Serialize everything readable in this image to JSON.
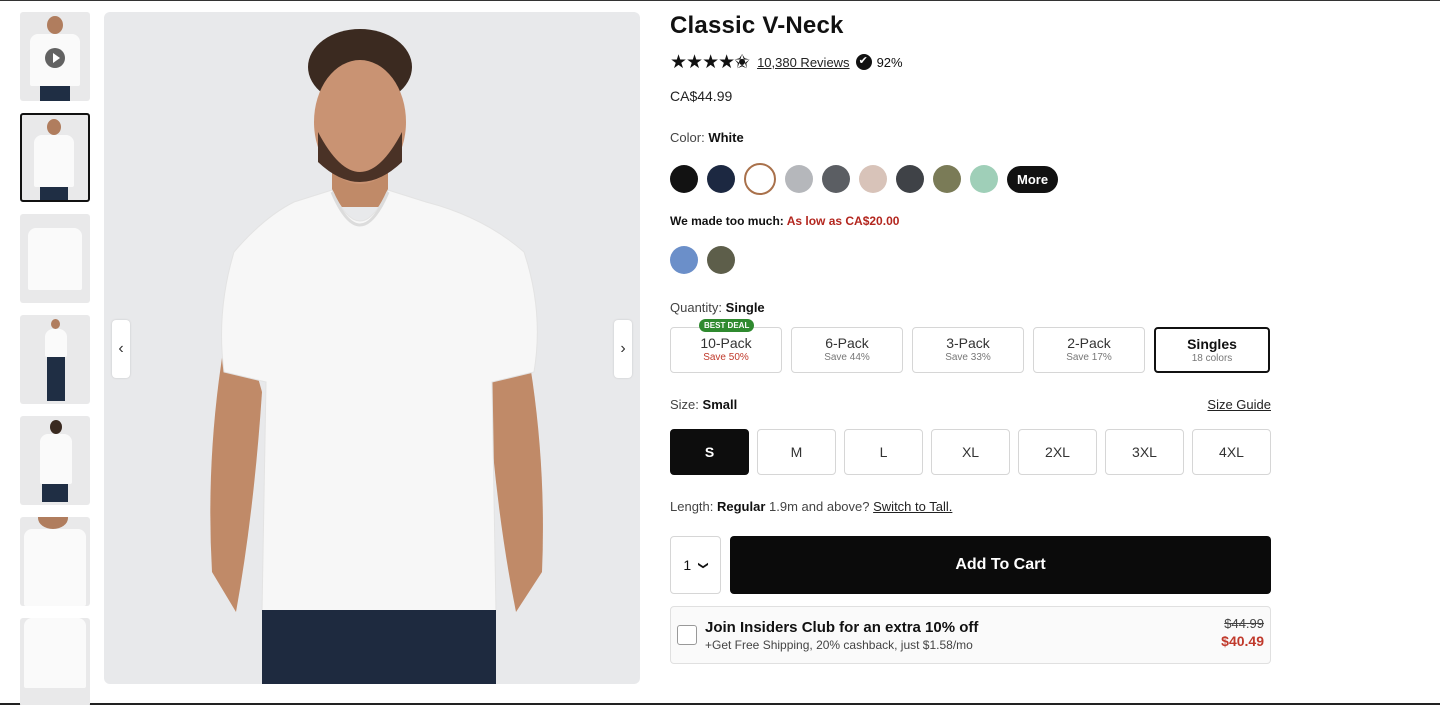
{
  "product": {
    "title": "Classic V-Neck",
    "rating_stars": "★★★★✬",
    "reviews_text": "10,380 Reviews",
    "recommend_percent": "92%",
    "price": "CA$44.99"
  },
  "color": {
    "label": "Color:",
    "selected": "White",
    "swatches": [
      "#121212",
      "#1c2841",
      "#ffffff",
      "#b5b7bb",
      "#5b5e63",
      "#d8c3b9",
      "#3f4247",
      "#7a7b57",
      "#9fcfb8"
    ],
    "more_label": "More",
    "promo_prefix": "We made too much:",
    "promo_highlight": "As low as CA$20.00",
    "clearance_swatches": [
      "#6b8fc9",
      "#5d5e4a"
    ]
  },
  "quantity": {
    "label": "Quantity:",
    "selected": "Single",
    "packs": [
      {
        "name": "10-Pack",
        "save": "Save 50%",
        "badge": "BEST DEAL"
      },
      {
        "name": "6-Pack",
        "save": "Save 44%"
      },
      {
        "name": "3-Pack",
        "save": "Save 33%"
      },
      {
        "name": "2-Pack",
        "save": "Save 17%"
      },
      {
        "name": "Singles",
        "save": "18 colors"
      }
    ]
  },
  "size": {
    "label": "Size:",
    "selected": "Small",
    "guide_label": "Size Guide",
    "options": [
      "S",
      "M",
      "L",
      "XL",
      "2XL",
      "3XL",
      "4XL"
    ]
  },
  "length": {
    "label": "Length:",
    "selected": "Regular",
    "prompt": "1.9m and above?",
    "link": "Switch to Tall."
  },
  "cart": {
    "qty_value": "1",
    "qty_chevron": "❯",
    "button_label": "Add To Cart"
  },
  "insiders": {
    "title": "Join Insiders Club for an extra 10% off",
    "subtitle": "+Get Free Shipping, 20% cashback, just $1.58/mo",
    "old_price": "$44.99",
    "new_price": "$40.49"
  },
  "gallery": {
    "prev_icon": "‹",
    "next_icon": "›"
  }
}
